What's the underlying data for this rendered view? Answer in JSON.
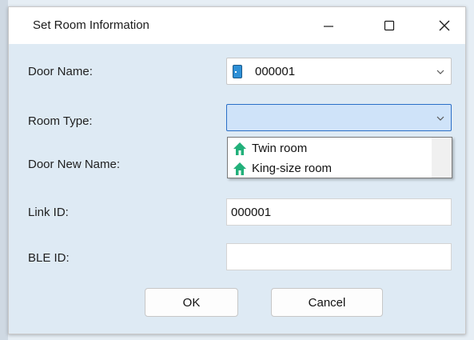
{
  "window": {
    "title": "Set Room Information"
  },
  "titlebar": {
    "minimize_icon": "minimize-icon",
    "maximize_icon": "maximize-icon",
    "close_icon": "close-icon"
  },
  "form": {
    "door_name": {
      "label": "Door Name:",
      "value": "000001",
      "icon": "door-icon"
    },
    "room_type": {
      "label": "Room Type:",
      "value": "",
      "options": [
        "Twin room",
        "King-size room"
      ],
      "option_icon": "house-icon"
    },
    "door_new_name": {
      "label": "Door New Name:"
    },
    "link_id": {
      "label": "Link ID:",
      "value": "000001"
    },
    "ble_id": {
      "label": "BLE ID:",
      "value": ""
    }
  },
  "buttons": {
    "ok": "OK",
    "cancel": "Cancel"
  },
  "colors": {
    "dialog_bg": "#deeaf4",
    "focus_border": "#2b6fc7",
    "focus_bg": "#cfe3f9",
    "house_icon": "#22b07a"
  }
}
